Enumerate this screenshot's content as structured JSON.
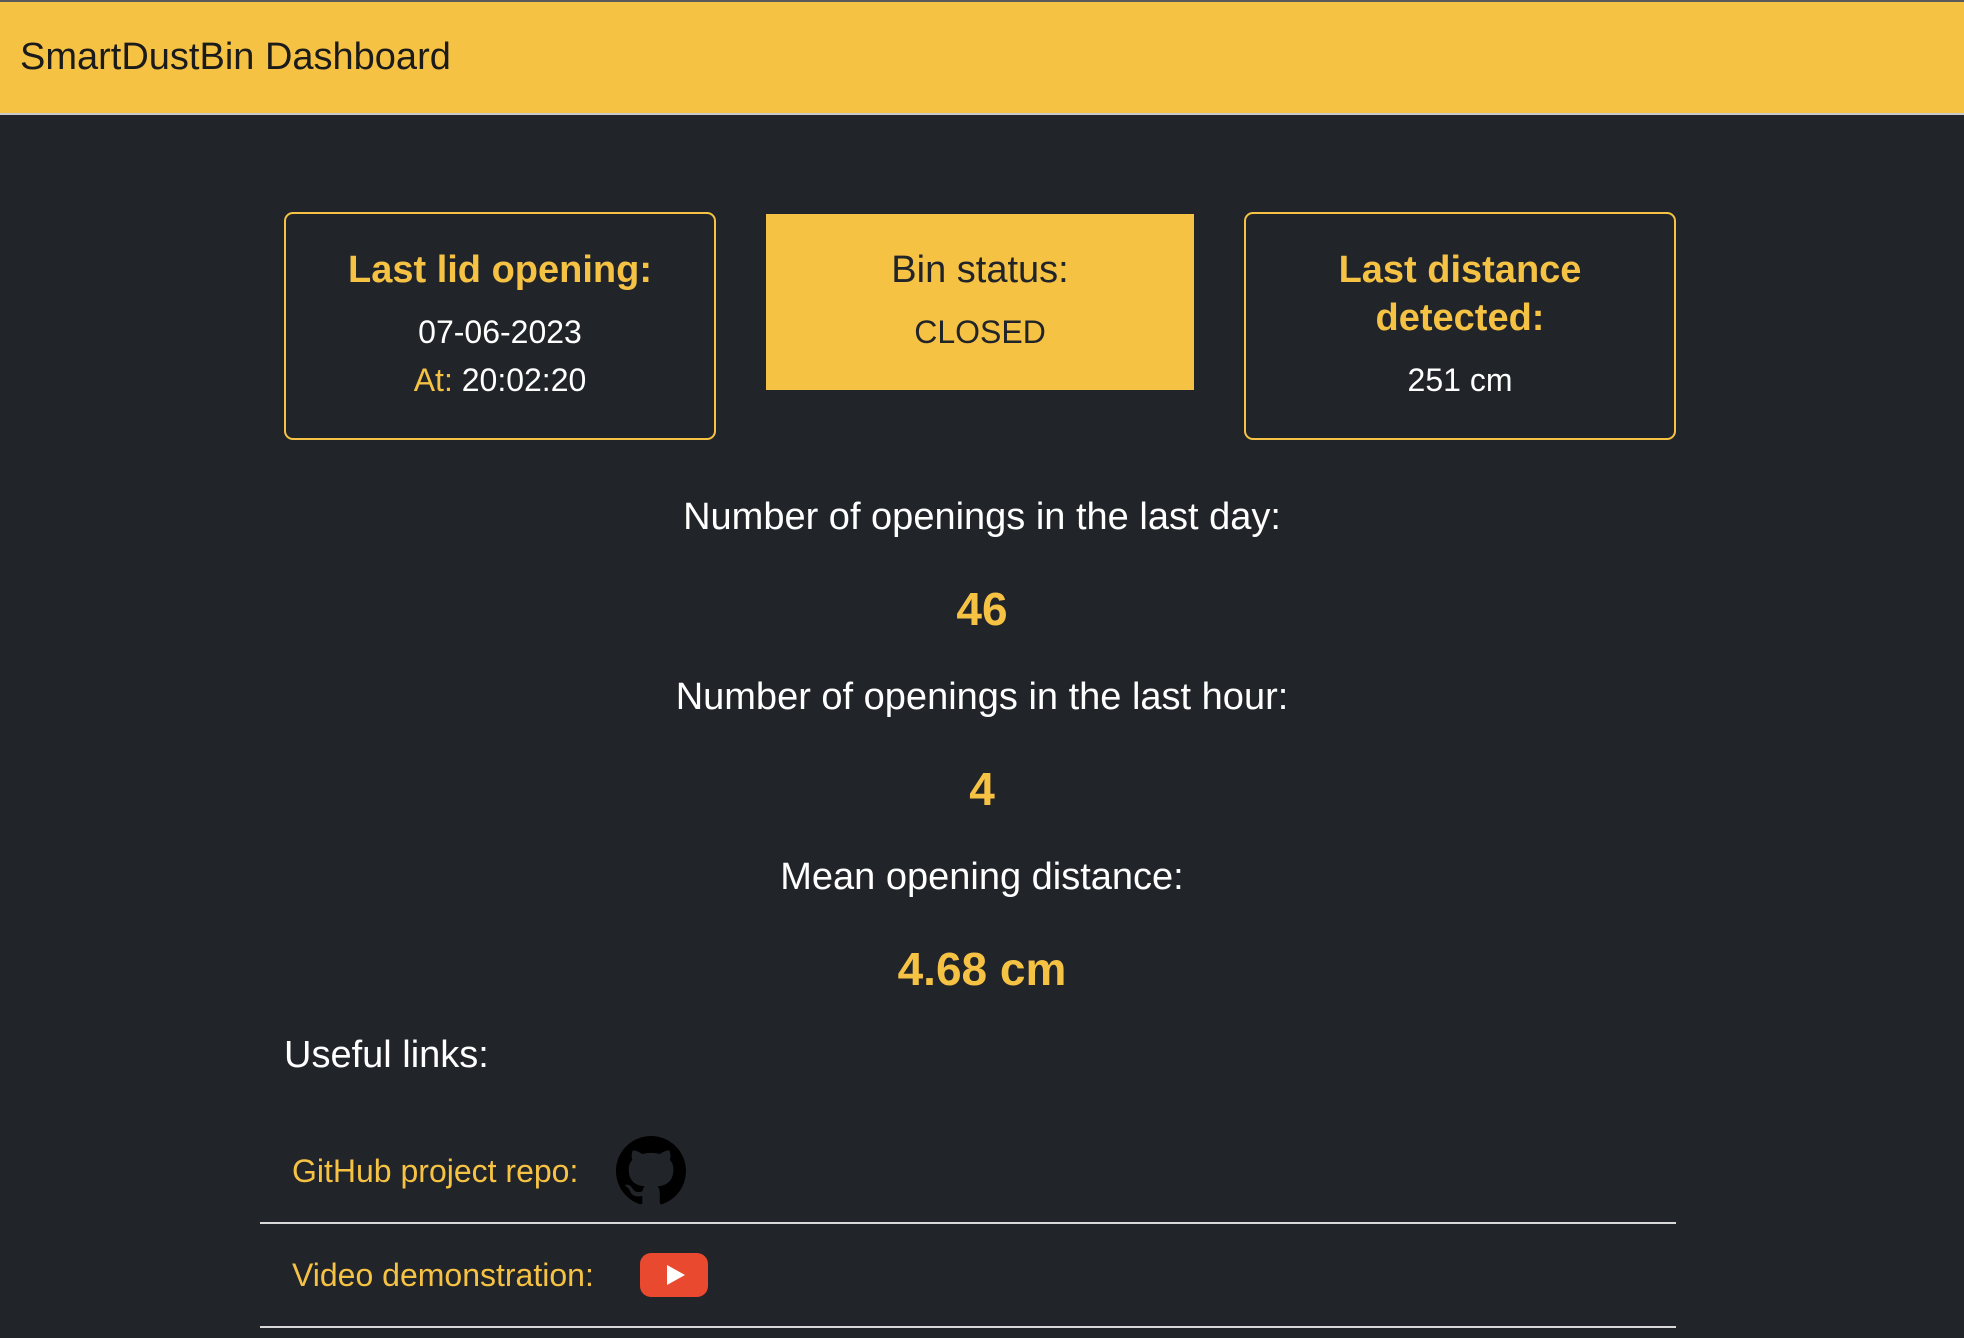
{
  "navbar": {
    "brand": "SmartDustBin Dashboard"
  },
  "cards": {
    "last_lid": {
      "title": "Last lid opening:",
      "date": "07-06-2023",
      "at_label": "At:",
      "time": "20:02:20"
    },
    "bin_status": {
      "title": "Bin status:",
      "value": "CLOSED"
    },
    "last_distance": {
      "title_line1": "Last distance",
      "title_line2": "detected:",
      "value": "251 cm"
    }
  },
  "stats": {
    "openings_day_label": "Number of openings in the last day:",
    "openings_day_value": "46",
    "openings_hour_label": "Number of openings in the last hour:",
    "openings_hour_value": "4",
    "mean_distance_label": "Mean opening distance:",
    "mean_distance_value": "4.68 cm"
  },
  "links": {
    "heading": "Useful links:",
    "items": [
      {
        "label": "GitHub project repo:",
        "icon": "github-icon"
      },
      {
        "label": "Video demonstration:",
        "icon": "youtube-icon"
      }
    ]
  },
  "colors": {
    "accent": "#f5c244",
    "background": "#212429",
    "youtube": "#e9492f"
  }
}
